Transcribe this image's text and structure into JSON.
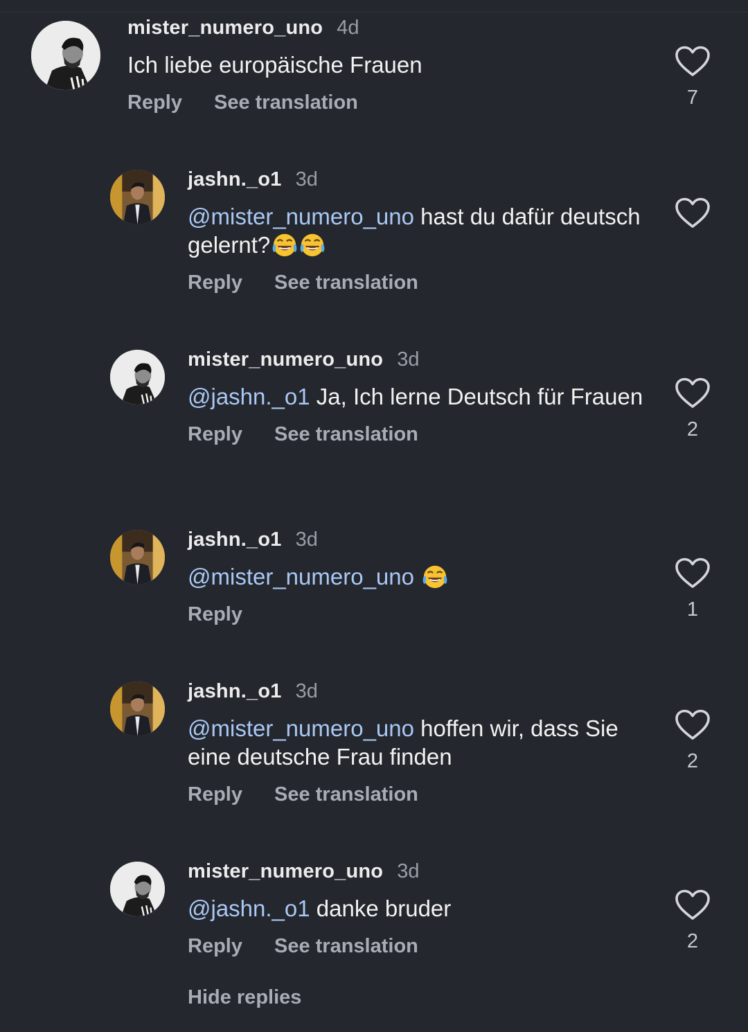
{
  "comments": [
    {
      "username": "mister_numero_uno",
      "time": "4d",
      "mention": "",
      "text": "Ich liebe europäische Frauen",
      "emojis": 0,
      "reply": "Reply",
      "translate": "See translation",
      "likes": "7",
      "avatar_style": "bw"
    },
    {
      "username": "jashn._o1",
      "time": "3d",
      "mention": "@mister_numero_uno",
      "text": " hast du dafür deutsch gelernt?",
      "emojis": 2,
      "reply": "Reply",
      "translate": "See translation",
      "likes": "",
      "avatar_style": "color"
    },
    {
      "username": "mister_numero_uno",
      "time": "3d",
      "mention": "@jashn._o1",
      "text": " Ja, Ich lerne Deutsch für Frauen",
      "emojis": 0,
      "reply": "Reply",
      "translate": "See translation",
      "likes": "2",
      "avatar_style": "bw"
    },
    {
      "username": "jashn._o1",
      "time": "3d",
      "mention": "@mister_numero_uno",
      "text": " ",
      "emojis": 1,
      "reply": "Reply",
      "translate": "",
      "likes": "1",
      "avatar_style": "color"
    },
    {
      "username": "jashn._o1",
      "time": "3d",
      "mention": "@mister_numero_uno",
      "text": " hoffen wir, dass Sie eine deutsche Frau finden",
      "emojis": 0,
      "reply": "Reply",
      "translate": "See translation",
      "likes": "2",
      "avatar_style": "color"
    },
    {
      "username": "mister_numero_uno",
      "time": "3d",
      "mention": "@jashn._o1",
      "text": " danke bruder",
      "emojis": 0,
      "reply": "Reply",
      "translate": "See translation",
      "likes": "2",
      "avatar_style": "bw"
    }
  ],
  "hide_replies": "Hide replies",
  "colors": {
    "background": "#24272d",
    "mention": "#a9c8f5",
    "muted": "#a8acb4"
  }
}
